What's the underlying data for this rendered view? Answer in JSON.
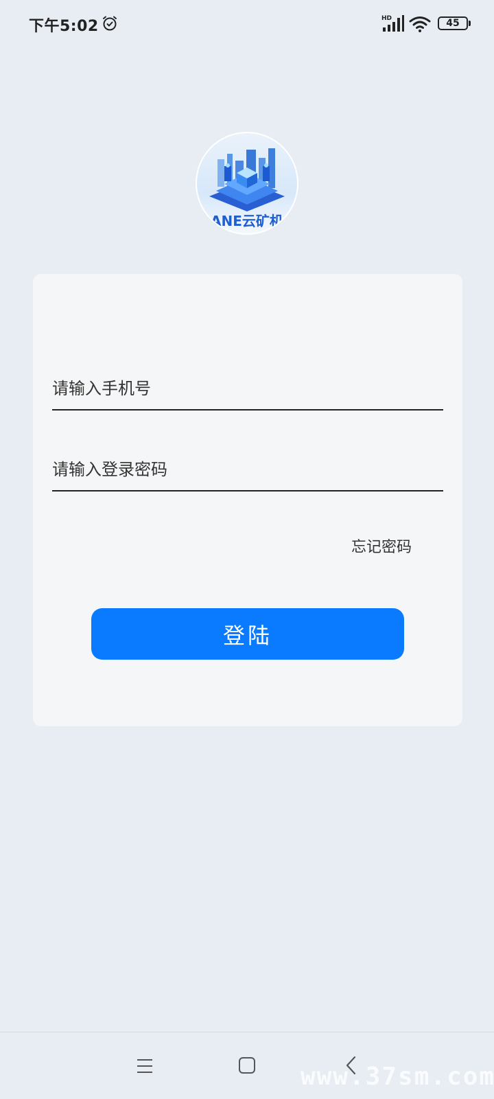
{
  "status_bar": {
    "time": "下午5:02",
    "network_label": "HD",
    "battery_level": "45",
    "icons": [
      "alarm-icon",
      "signal-icon",
      "wifi-icon",
      "battery-icon"
    ]
  },
  "logo": {
    "text": "ANE云矿机"
  },
  "login_form": {
    "phone_placeholder": "请输入手机号",
    "password_placeholder": "请输入登录密码",
    "forgot_password": "忘记密码",
    "login_button": "登陆"
  },
  "navigation_bar": {
    "icons": [
      "menu-icon",
      "home-icon",
      "back-icon"
    ]
  },
  "watermark": {
    "text": "www.37sm.com"
  },
  "colors": {
    "background": "#e8edf4",
    "card": "#f5f6f7",
    "primary": "#0a7bff",
    "text": "#222222"
  }
}
